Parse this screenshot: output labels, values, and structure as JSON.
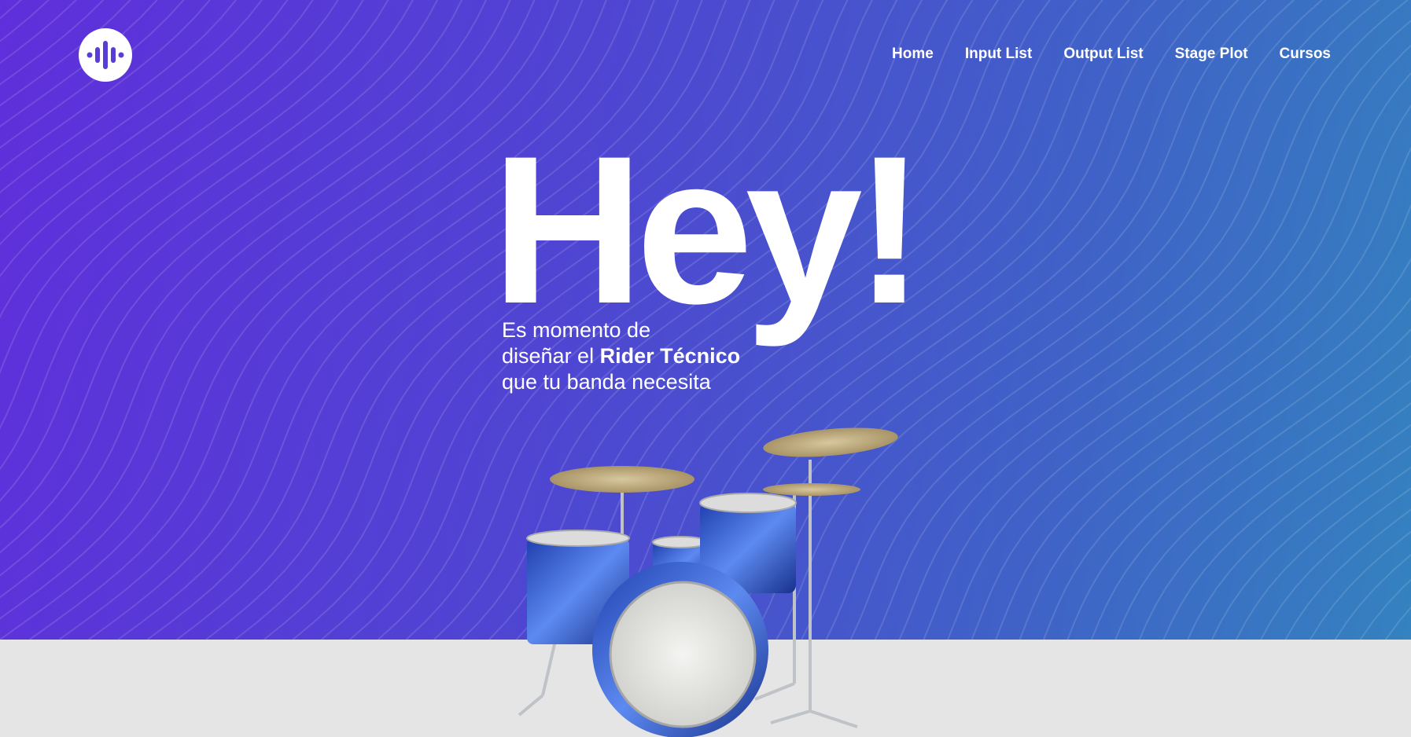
{
  "logo": {
    "icon": "soundwave-icon",
    "background": "#ffffff",
    "accent": "#5a3cd6"
  },
  "nav": {
    "items": [
      {
        "label": "Home"
      },
      {
        "label": "Input List"
      },
      {
        "label": "Output List"
      },
      {
        "label": "Stage Plot"
      },
      {
        "label": "Cursos"
      }
    ]
  },
  "hero": {
    "headline": "Hey!",
    "tagline": {
      "line1": "Es momento de",
      "line2_prefix": "diseñar el ",
      "line2_bold": "Rider Técnico",
      "line3": "que tu banda necesita"
    },
    "image": "drum-kit-image",
    "colors": {
      "gradient_start": "#5f2fdb",
      "gradient_end": "#3482bf",
      "floor": "#e5e5e6"
    }
  }
}
